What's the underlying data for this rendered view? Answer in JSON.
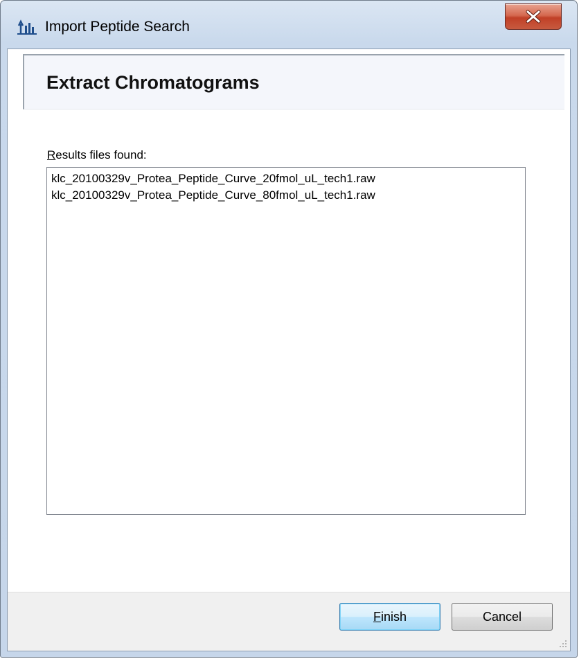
{
  "window": {
    "title": "Import Peptide Search",
    "close_glyph": "X"
  },
  "header": {
    "title": "Extract Chromatograms"
  },
  "results": {
    "label_accel": "R",
    "label_rest": "esults files found:",
    "files": [
      "klc_20100329v_Protea_Peptide_Curve_20fmol_uL_tech1.raw",
      "klc_20100329v_Protea_Peptide_Curve_80fmol_uL_tech1.raw"
    ]
  },
  "footer": {
    "finish_accel": "F",
    "finish_rest": "inish",
    "cancel_label": "Cancel"
  },
  "icons": {
    "app": "skyline-app-icon",
    "close": "close-icon",
    "grip": "resize-grip-icon"
  },
  "colors": {
    "close_button": "#c75a3f",
    "default_button_border": "#3c7fb1",
    "header_panel_bg": "#f4f6fb"
  }
}
